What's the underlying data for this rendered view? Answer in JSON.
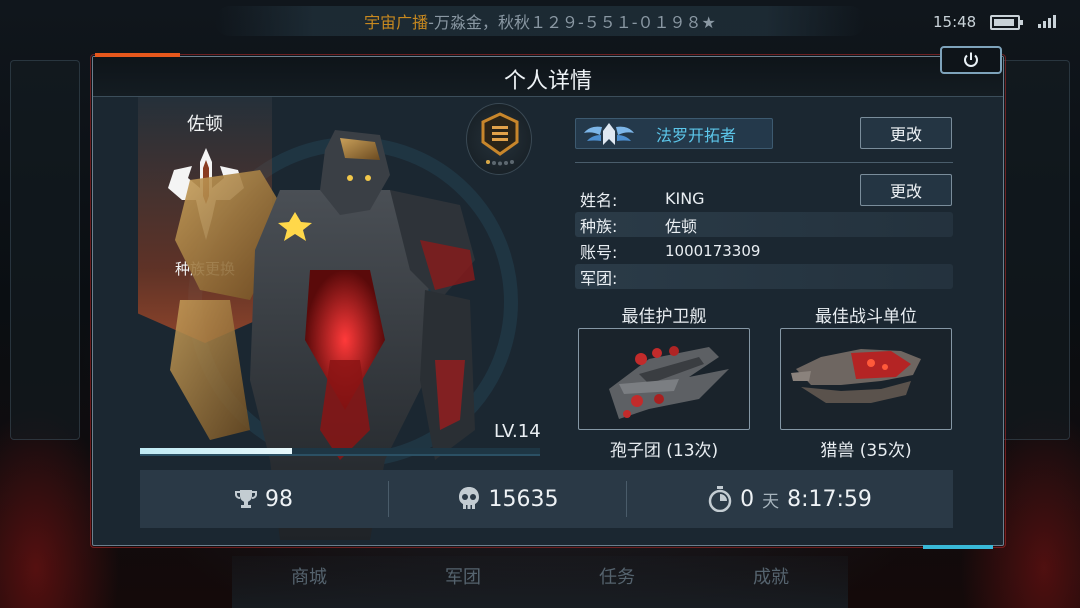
{
  "status_bar": {
    "broadcast_source": "宇宙广播",
    "broadcast_text": "-万淼金，秋秋１２９-５５１-０１９８★",
    "time": "15:48",
    "battery_level": 0.9
  },
  "panel": {
    "title": "个人详情"
  },
  "race": {
    "name": "佐顿",
    "switch_label": "种族更换",
    "icon": "zordon-race-emblem-icon"
  },
  "hero": {
    "level": "LV.14",
    "xp_fraction": 0.38
  },
  "title_badge": {
    "label": "法罗开拓者",
    "icon": "winged-emblem-icon"
  },
  "buttons": {
    "change_title": "更改",
    "change_name": "更改"
  },
  "profile": {
    "rows": [
      {
        "key": "姓名:",
        "value": "KING"
      },
      {
        "key": "种族:",
        "value": "佐顿"
      },
      {
        "key": "账号:",
        "value": "1000173309"
      },
      {
        "key": "军团:",
        "value": ""
      }
    ]
  },
  "best": {
    "escort_label": "最佳护卫舰",
    "escort_name": "孢子团 (13次)",
    "unit_label": "最佳战斗单位",
    "unit_name": "猎兽 (35次)"
  },
  "stats": {
    "trophies": "98",
    "kills": "15635",
    "days": "0",
    "days_unit": "天",
    "time": "8:17:59"
  },
  "bottom_nav": [
    "商城",
    "军团",
    "任务",
    "成就"
  ],
  "colors": {
    "accent_orange": "#e6571c",
    "accent_cyan": "#39b9d8",
    "title_text": "#5cc6ea"
  }
}
